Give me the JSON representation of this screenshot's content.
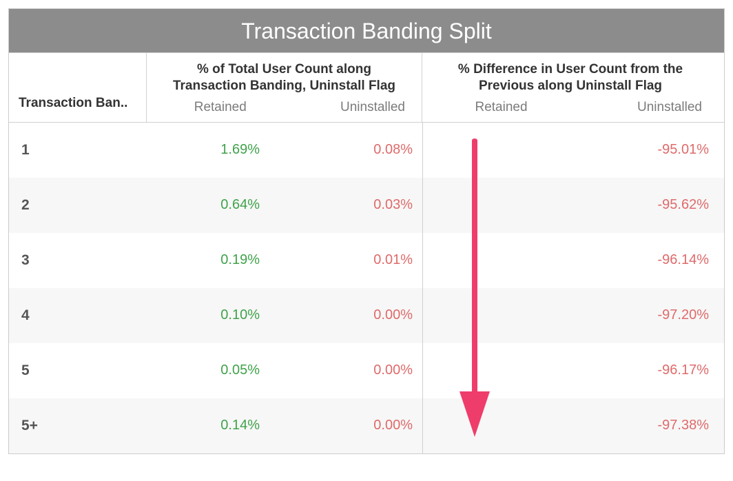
{
  "title": "Transaction Banding Split",
  "columns": {
    "rowHeader": "Transaction Ban..",
    "group1": {
      "title": "% of Total User Count along Transaction Banding, Uninstall Flag",
      "sub": [
        "Retained",
        "Uninstalled"
      ]
    },
    "group2": {
      "title": "% Difference in User Count from the Previous along Uninstall Flag",
      "sub": [
        "Retained",
        "Uninstalled"
      ]
    }
  },
  "colors": {
    "retained": "#3fa24a",
    "uninstalled": "#df6a6a",
    "arrow": "#ef3d6b"
  },
  "rows": [
    {
      "band": "1",
      "retained": "1.69%",
      "uninstalled": "0.08%",
      "diffRetained": "",
      "diffUninstalled": "-95.01%"
    },
    {
      "band": "2",
      "retained": "0.64%",
      "uninstalled": "0.03%",
      "diffRetained": "",
      "diffUninstalled": "-95.62%"
    },
    {
      "band": "3",
      "retained": "0.19%",
      "uninstalled": "0.01%",
      "diffRetained": "",
      "diffUninstalled": "-96.14%"
    },
    {
      "band": "4",
      "retained": "0.10%",
      "uninstalled": "0.00%",
      "diffRetained": "",
      "diffUninstalled": "-97.20%"
    },
    {
      "band": "5",
      "retained": "0.05%",
      "uninstalled": "0.00%",
      "diffRetained": "",
      "diffUninstalled": "-96.17%"
    },
    {
      "band": "5+",
      "retained": "0.14%",
      "uninstalled": "0.00%",
      "diffRetained": "",
      "diffUninstalled": "-97.38%"
    }
  ],
  "chart_data": {
    "type": "table",
    "title": "Transaction Banding Split",
    "categories": [
      "1",
      "2",
      "3",
      "4",
      "5",
      "5+"
    ],
    "series": [
      {
        "name": "% of Total User Count — Retained",
        "values": [
          1.69,
          0.64,
          0.19,
          0.1,
          0.05,
          0.14
        ]
      },
      {
        "name": "% of Total User Count — Uninstalled",
        "values": [
          0.08,
          0.03,
          0.01,
          0.0,
          0.0,
          0.0
        ]
      },
      {
        "name": "% Difference from Previous — Retained",
        "values": [
          null,
          null,
          null,
          null,
          null,
          null
        ]
      },
      {
        "name": "% Difference from Previous — Uninstalled",
        "values": [
          -95.01,
          -95.62,
          -96.14,
          -97.2,
          -96.17,
          -97.38
        ]
      }
    ],
    "xlabel": "Transaction Banding",
    "ylabel": ""
  }
}
